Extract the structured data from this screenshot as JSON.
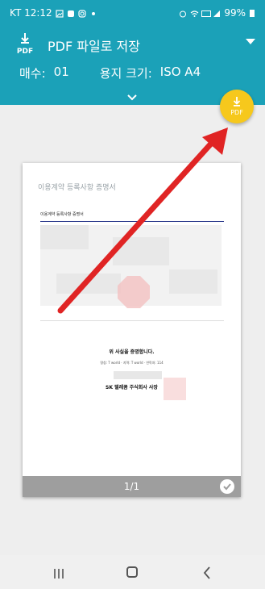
{
  "status": {
    "time_label": "KT 12:12",
    "battery": "99%"
  },
  "header": {
    "title": "PDF 파일로 저장",
    "pdf_icon_text": "PDF",
    "copies_label": "매수:",
    "copies_value": "01",
    "paper_label": "용지 크기:",
    "paper_value": "ISO A4"
  },
  "fab": {
    "label": "PDF"
  },
  "preview": {
    "doc_heading": "이용계약 등록사항 증명서",
    "doc_subheading": "이용계약 등록사항 증명서",
    "certify_text": "위 사실을 증명합니다.",
    "small_info": "명칭: T world  ·  지역: T world  ·  연락처: 114",
    "company_text": "SK 텔레콤 주식회사 사장",
    "watermark_text": "픽",
    "page_indicator": "1/1"
  },
  "colors": {
    "header_bg": "#1ba1b8",
    "fab_bg": "#f6c81c",
    "arrow": "#e02424"
  }
}
